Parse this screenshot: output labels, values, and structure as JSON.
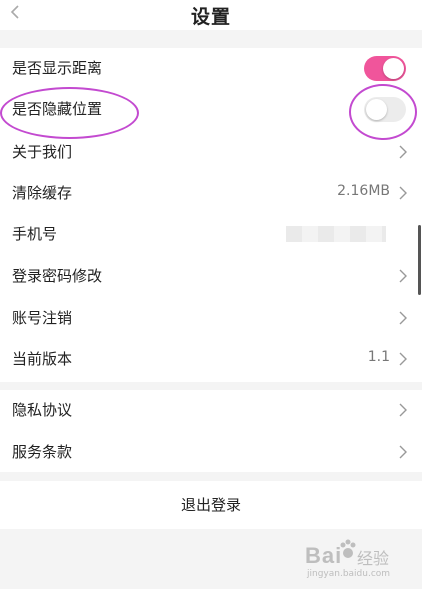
{
  "header": {
    "title": "设置",
    "back_icon": "chevron-left-icon"
  },
  "settings": {
    "show_distance": {
      "label": "是否显示距离",
      "enabled": true
    },
    "hide_location": {
      "label": "是否隐藏位置",
      "enabled": false
    },
    "about_us": {
      "label": "关于我们"
    },
    "clear_cache": {
      "label": "清除缓存",
      "value": "2.16MB"
    },
    "phone": {
      "label": "手机号"
    },
    "change_password": {
      "label": "登录密码修改"
    },
    "account_cancel": {
      "label": "账号注销"
    },
    "current_version": {
      "label": "当前版本",
      "value": "1.1"
    },
    "privacy": {
      "label": "隐私协议"
    },
    "terms": {
      "label": "服务条款"
    }
  },
  "logout": {
    "label": "退出登录"
  },
  "colors": {
    "toggle_on": "#f0559b",
    "toggle_off": "#ececec",
    "annotation": "#c34ad0"
  },
  "watermark": {
    "brand": "Bai",
    "cn": "经验",
    "url": "jingyan.baidu.com"
  }
}
